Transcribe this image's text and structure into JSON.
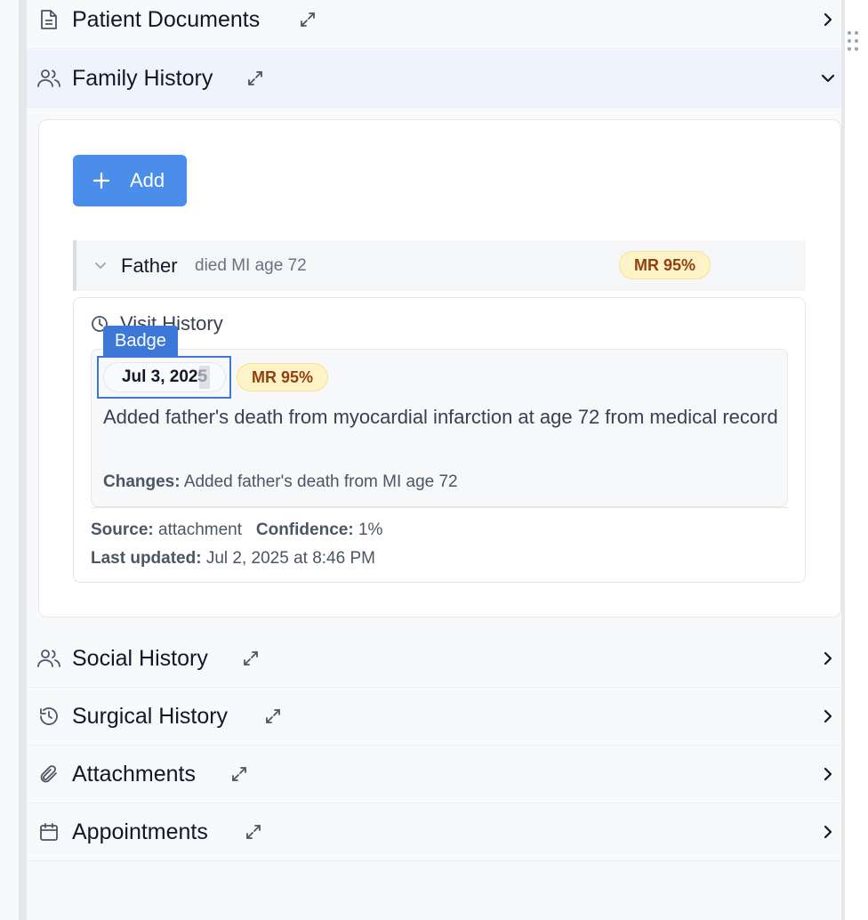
{
  "sections": {
    "patient_documents": {
      "title": "Patient Documents"
    },
    "family_history": {
      "title": "Family History",
      "add_label": "Add",
      "member": {
        "relation": "Father",
        "description": "died MI age 72",
        "badge": "MR 95%"
      },
      "visit_history": {
        "title": "Visit History",
        "entry": {
          "date": "Jul 3, 2025",
          "badge": "MR 95%",
          "text": "Added father's death from myocardial infarction at age 72 from medical record",
          "changes_label": "Changes:",
          "changes_value": "Added father's death from MI age 72"
        },
        "source_label": "Source:",
        "source_value": "attachment",
        "confidence_label": "Confidence:",
        "confidence_value": "1%",
        "updated_label": "Last updated:",
        "updated_value": "Jul 2, 2025 at 8:46 PM"
      }
    },
    "social_history": {
      "title": "Social History"
    },
    "surgical_history": {
      "title": "Surgical History"
    },
    "attachments": {
      "title": "Attachments"
    },
    "appointments": {
      "title": "Appointments"
    }
  },
  "overlay": {
    "selection_label": "Badge"
  },
  "colors": {
    "accent": "#4a8eea",
    "selection": "#3b78d8",
    "badge_bg": "#fdf3c7",
    "badge_text": "#92400e"
  }
}
